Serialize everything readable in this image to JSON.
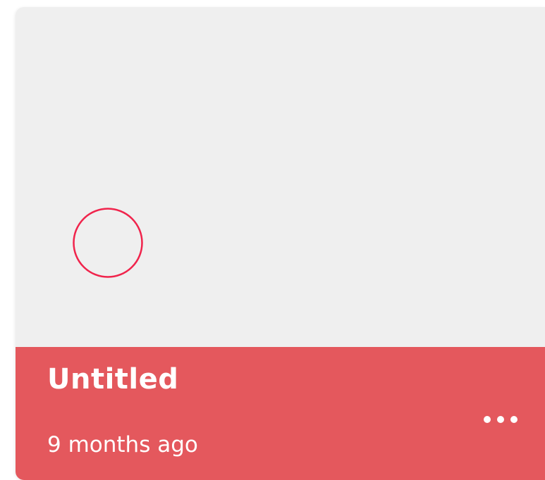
{
  "card": {
    "title": "Untitled",
    "timestamp": "9 months ago",
    "more_icon": "more-horizontal-icon",
    "thumbnail_shape": "circle-outline"
  },
  "colors": {
    "footer_bg": "#e4585d",
    "thumbnail_bg": "#efefef",
    "shape_stroke": "#f0244c",
    "text": "#ffffff"
  }
}
